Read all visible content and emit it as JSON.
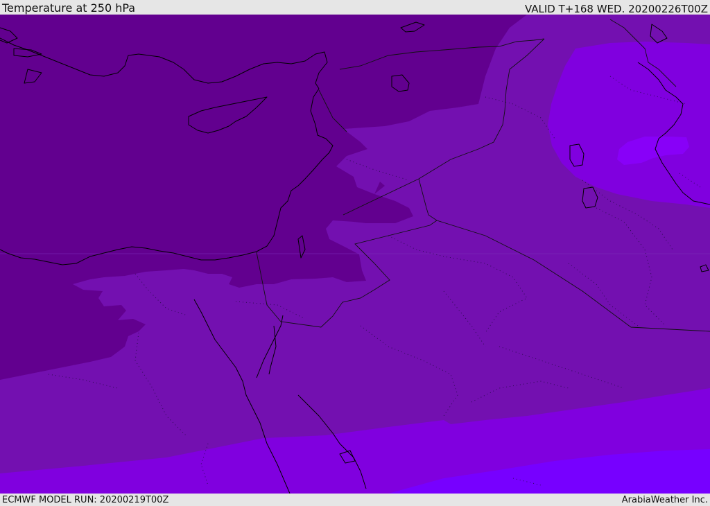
{
  "header": {
    "title": "Temperature at 250 hPa",
    "valid": "VALID T+168 WED. 20200226T00Z"
  },
  "footer": {
    "model_run": "ECMWF MODEL RUN: 20200219T00Z",
    "credit": "ArabiaWeather Inc."
  },
  "map": {
    "region": "Eastern Mediterranean and Middle East",
    "field": "Temperature at 250 hPa",
    "colors": {
      "band_darkest": "#62008f",
      "band_dark": "#7310b0",
      "band_mid": "#8000df",
      "band_bright": "#8800f8",
      "band_brightest": "#7700ff"
    }
  }
}
